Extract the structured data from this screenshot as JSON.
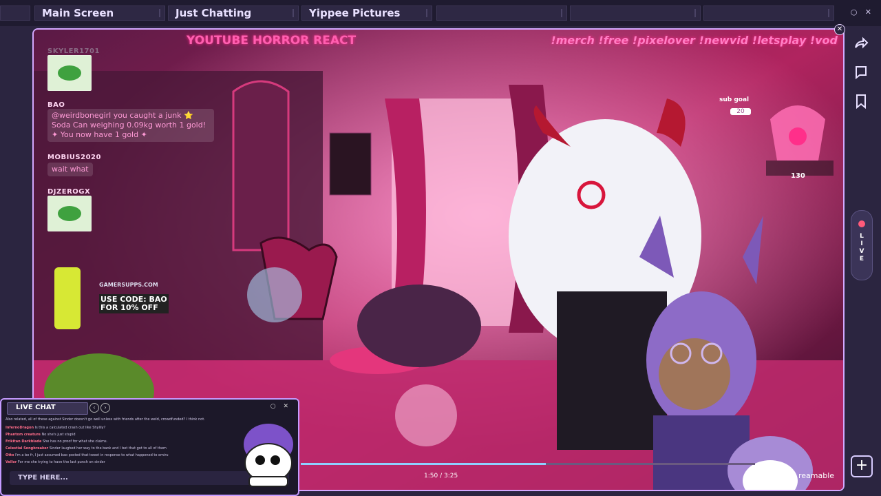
{
  "tabs": [
    {
      "label": "Main Screen"
    },
    {
      "label": "Just Chatting"
    },
    {
      "label": "Yippee Pictures"
    },
    {
      "label": ""
    },
    {
      "label": ""
    },
    {
      "label": ""
    }
  ],
  "window_controls": "○ ✕",
  "overlay": {
    "title": "YOUTUBE HORROR REACT",
    "commands": "!merch !free !pixelover !newvid !letsplay !vod"
  },
  "chat_overlay": [
    {
      "user": "SKYLER1701",
      "type": "emote"
    },
    {
      "user": "BAO",
      "message": "@weirdbonegirl you caught a junk ⭐ Soda Can weighing 0.09kg worth 1 gold! ✦ You now have 1 gold ✦"
    },
    {
      "user": "MOBIUS2020",
      "message": "wait what"
    },
    {
      "user": "DJZEROGX",
      "type": "emote"
    }
  ],
  "promo": {
    "brand": "GAMERSUPPS.COM",
    "code": "USE CODE: BAO",
    "offer": "FOR 10% OFF"
  },
  "subgoal": {
    "label": "sub goal",
    "value": "20",
    "shell_count": "130"
  },
  "live_badge": "LIVE",
  "live_chat": {
    "header": "LIVE CHAT",
    "input_placeholder": "TYPE HERE...",
    "messages": [
      {
        "user": "",
        "text": "Also related, all of these against Sinder doesn't go well unless with friends after the weld, crowdfunded? I think not."
      },
      {
        "user": "InfernoDragon",
        "text": "Is this a calculated crash out like Shylily?"
      },
      {
        "user": "Phantom creature",
        "text": "No she's just stupid"
      },
      {
        "user": "Frikitan Darkblade",
        "text": "She has no proof for what she claims."
      },
      {
        "user": "Celestial Songbreaker",
        "text": "Sinder laughed her way to the bank and I bet that got to all of them"
      },
      {
        "user": "Otto",
        "text": "I'm a be fr, I just assumed bao posted that tweet in response to what happened to emiru"
      },
      {
        "user": "Vellor",
        "text": "For me she trying to have the last punch on sinder"
      }
    ]
  },
  "video": {
    "time": "1:50 / 3:25",
    "progress": 0.54,
    "brand": "reamable"
  },
  "accent": "#c59bff"
}
